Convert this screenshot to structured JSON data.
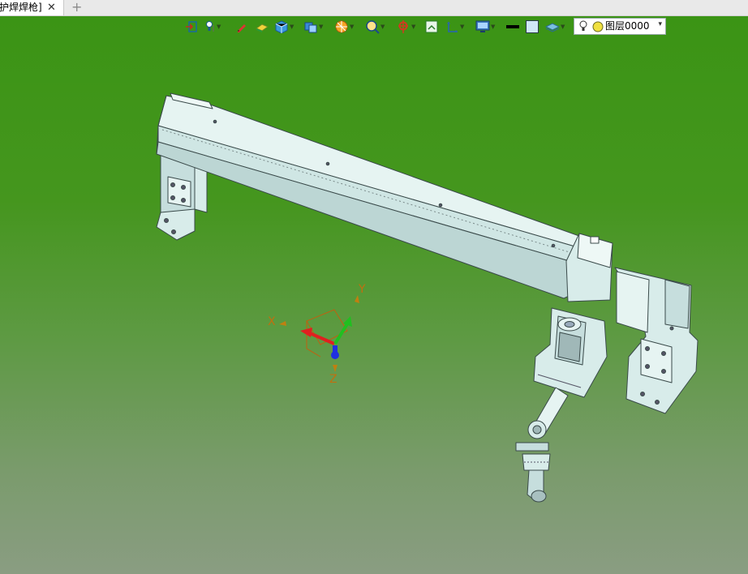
{
  "tab": {
    "title": "护焊焊枪]",
    "close_glyph": "✕",
    "new_glyph": "+"
  },
  "toolbar": {
    "icons": [
      "exit-sketch-icon",
      "light-icon",
      "pen-icon",
      "eraser-icon",
      "cube-icon",
      "view-cube-icon",
      "render-style-icon",
      "zoom-icon",
      "pan-icon",
      "fit-view-icon",
      "section-icon",
      "display-icon",
      "line-color-icon",
      "fill-color-icon",
      "layer-stack-icon"
    ],
    "layer": {
      "name": "图层0000",
      "dropdown_glyph": "▾"
    }
  },
  "triad": {
    "x_label": "X",
    "y_label": "Y",
    "z_label": "Z"
  },
  "colors": {
    "background_top": "#3a9414",
    "background_bottom": "#8a9d82",
    "model": "#d8ecea",
    "model_edge": "#3a4a4a",
    "x_axis": "#e02020",
    "y_axis": "#20c020",
    "z_axis": "#2030e0",
    "axis_label": "#c07010"
  }
}
